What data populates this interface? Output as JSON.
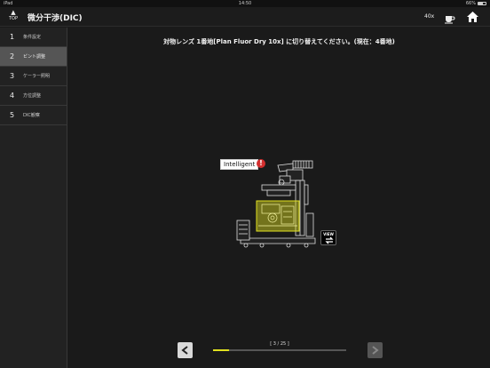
{
  "status_bar": {
    "device": "iPad",
    "time": "14:50",
    "battery_pct": "66%",
    "battery_level": 0.66
  },
  "header": {
    "top_label": "TOP",
    "title": "微分干渉(DIC)",
    "magnification": "40x",
    "icons": {
      "top": "up-arrow-icon",
      "coffee": "coffee-cup-icon",
      "home": "home-icon"
    }
  },
  "sidebar": {
    "steps": [
      {
        "num": "1",
        "label": "条件設定",
        "active": false
      },
      {
        "num": "2",
        "label": "ピント調整",
        "active": true
      },
      {
        "num": "3",
        "label": "ケーラー照明",
        "active": false
      },
      {
        "num": "4",
        "label": "方位調整",
        "active": false
      },
      {
        "num": "5",
        "label": "DIC観察",
        "active": false
      }
    ]
  },
  "main": {
    "instruction": "対物レンズ 1番地[Plan Fluor Dry 10x] に切り替えてください。(現在：4番地)",
    "badge": "Intelligent",
    "warning": "!",
    "view_label": "VIEW",
    "page_indicator": "[ 3 / 25 ]",
    "progress": 0.12,
    "colors": {
      "highlight": "#e0e020",
      "accent": "#d32f2f"
    }
  }
}
